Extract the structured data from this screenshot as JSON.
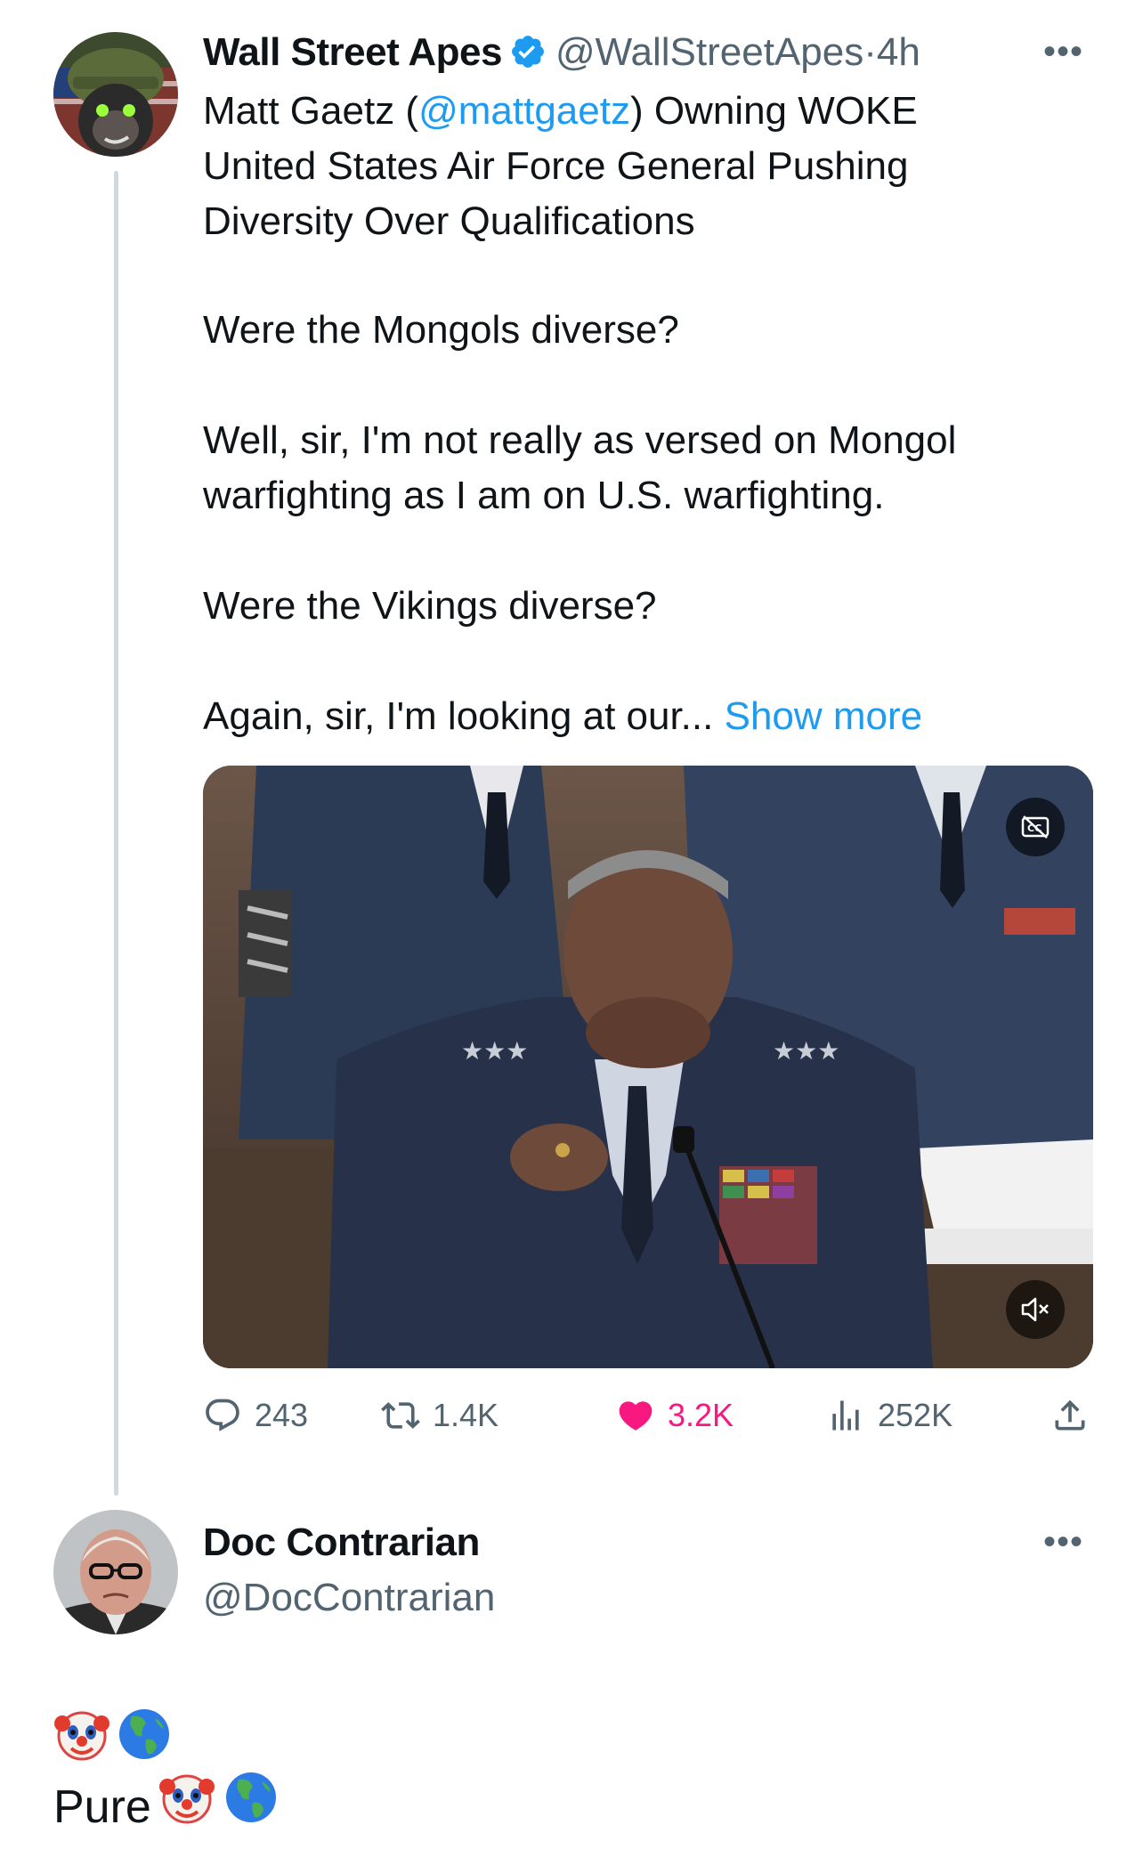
{
  "tweet": {
    "author_name": "Wall Street Apes",
    "handle": "@WallStreetApes",
    "separator": "·",
    "time": "4h",
    "more_label": "•••",
    "text": {
      "line1_prefix": "Matt Gaetz (",
      "mention": "@mattgaetz",
      "line1_suffix": ") Owning WOKE",
      "line2": "United States Air Force General Pushing",
      "line3": "Diversity Over Qualifications",
      "para2": "Were the Mongols diverse?",
      "para3_line1": "Well, sir, I'm not really as versed on Mongol",
      "para3_line2": "warfighting as I am on U.S. warfighting.",
      "para4": "Were the Vikings diverse?",
      "para5": "Again, sir, I'm looking at our...",
      "show_more": "Show more"
    },
    "media": {
      "type": "video",
      "cc_icon": "closed-captions-off-icon",
      "mute_icon": "muted-speaker-icon"
    },
    "actions": {
      "replies": "243",
      "reposts": "1.4K",
      "likes": "3.2K",
      "views": "252K",
      "liked": true,
      "like_color": "#f91880"
    }
  },
  "reply": {
    "author_name": "Doc Contrarian",
    "handle": "@DocContrarian",
    "more_label": "•••",
    "emoji_line": [
      "clown-face-emoji",
      "globe-americas-emoji"
    ],
    "text": "Pure",
    "text_emojis": [
      "clown-face-emoji",
      "globe-americas-emoji"
    ]
  },
  "colors": {
    "link": "#1d9bf0",
    "muted": "#536471",
    "like": "#f91880",
    "thread_line": "#cfd9de"
  }
}
